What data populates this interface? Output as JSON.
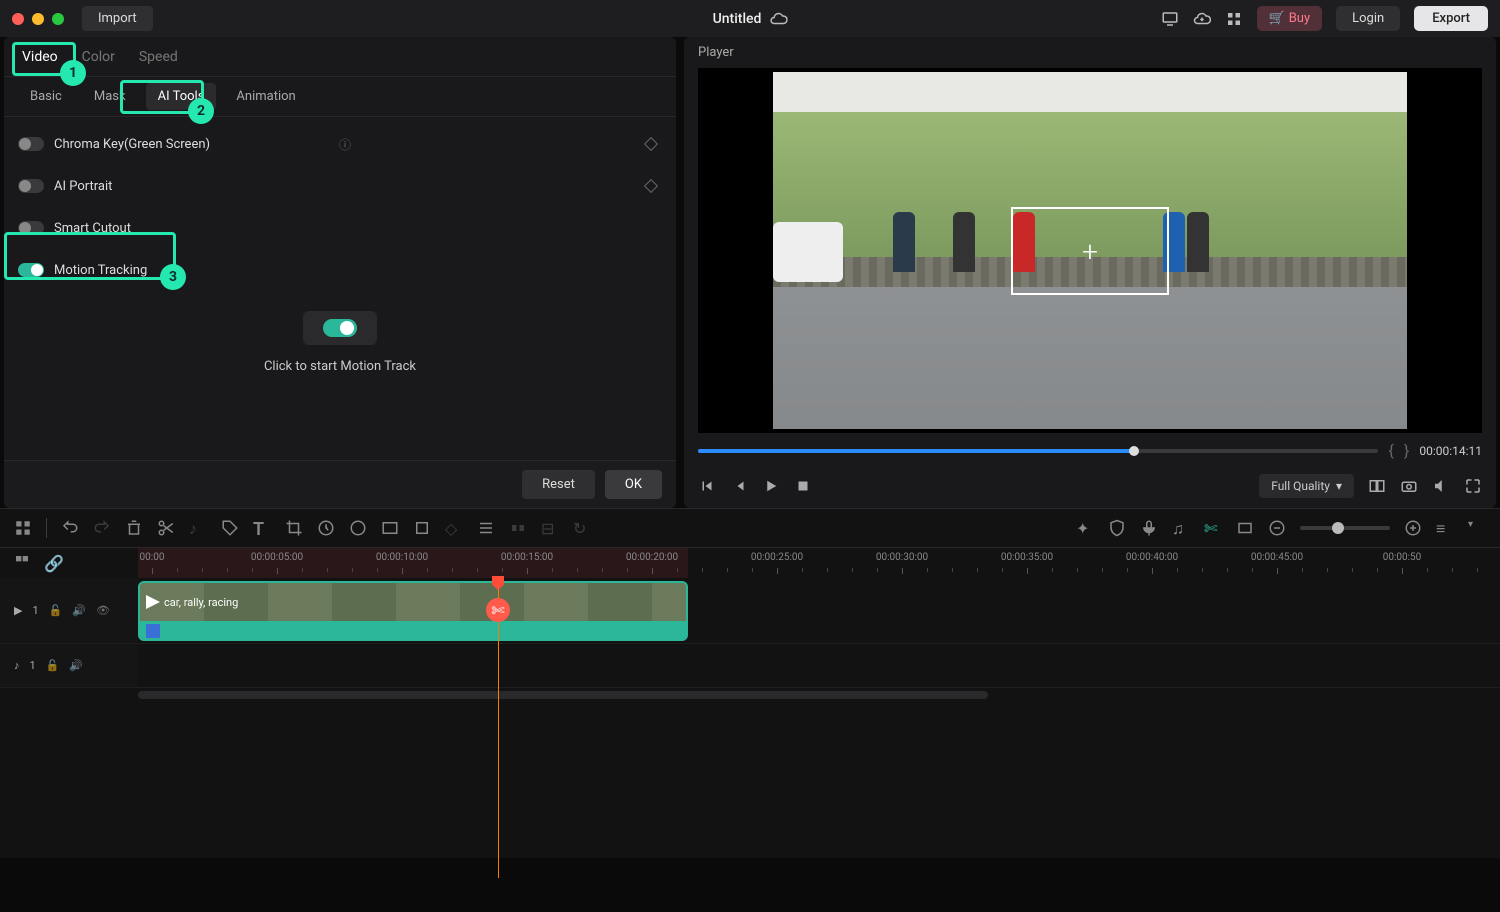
{
  "titlebar": {
    "import": "Import",
    "title": "Untitled",
    "buy": "Buy",
    "login": "Login",
    "export": "Export"
  },
  "top_tabs": {
    "video": "Video",
    "color": "Color",
    "speed": "Speed"
  },
  "sub_tabs": {
    "basic": "Basic",
    "mask": "Mask",
    "ai": "AI Tools",
    "anim": "Animation"
  },
  "tools": {
    "chroma": "Chroma Key(Green Screen)",
    "portrait": "AI Portrait",
    "cutout": "Smart Cutout",
    "motion": "Motion Tracking"
  },
  "motion_hint": "Click to start Motion Track",
  "buttons": {
    "reset": "Reset",
    "ok": "OK"
  },
  "player": {
    "label": "Player",
    "timecode": "00:00:14:11",
    "quality": "Full Quality"
  },
  "ruler": {
    "marks": [
      "00:00",
      "00:00:05:00",
      "00:00:10:00",
      "00:00:15:00",
      "00:00:20:00",
      "00:00:25:00",
      "00:00:30:00",
      "00:00:35:00",
      "00:00:40:00",
      "00:00:45:00",
      "00:00:50"
    ]
  },
  "tracks": {
    "v1": "1",
    "a1": "1",
    "clip_label": "car, rally, racing"
  },
  "highlights": {
    "h1": "1",
    "h2": "2",
    "h3": "3"
  }
}
